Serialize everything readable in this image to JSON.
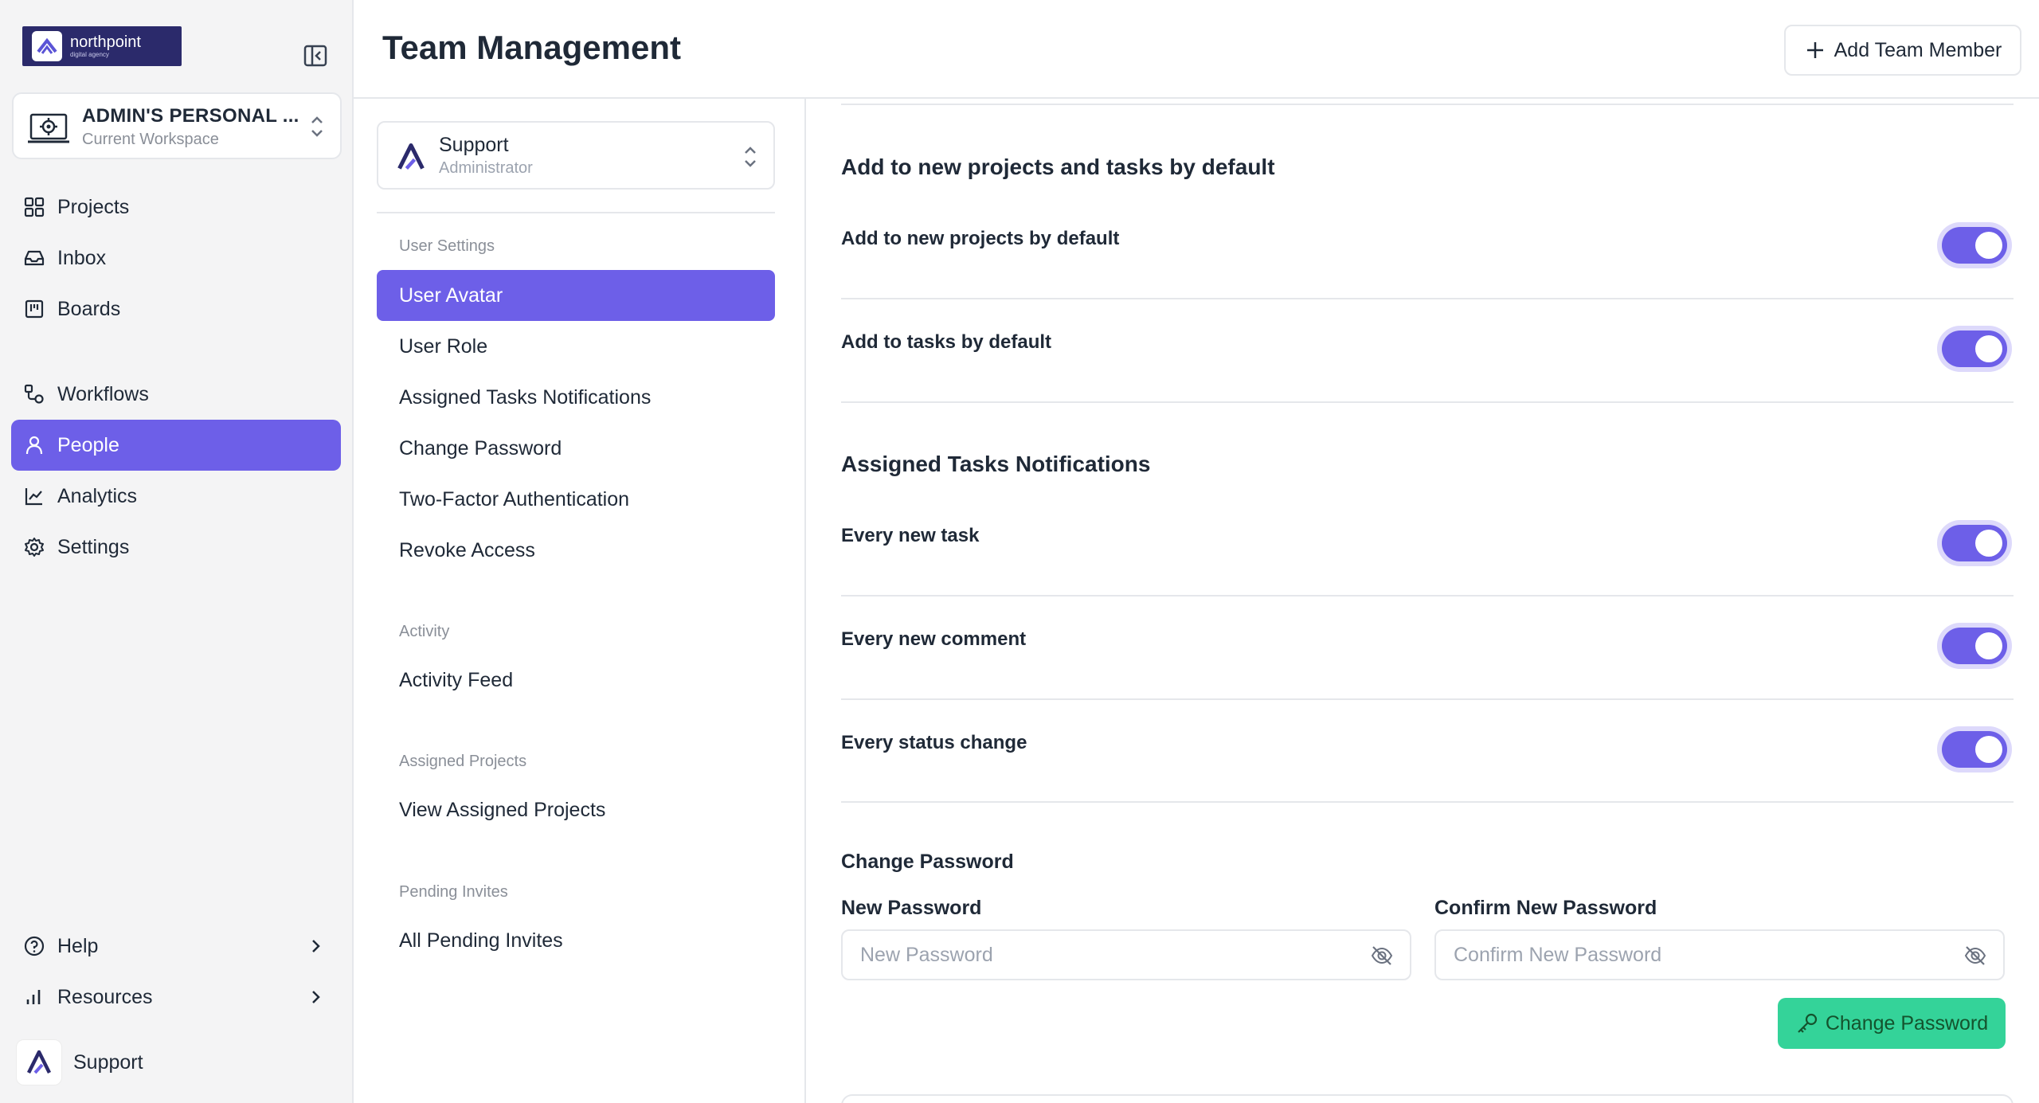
{
  "brand": {
    "name": "northpoint",
    "tagline": "digital agency"
  },
  "workspace": {
    "name": "ADMIN'S PERSONAL ...",
    "subtitle": "Current Workspace"
  },
  "nav": {
    "projects": "Projects",
    "inbox": "Inbox",
    "boards": "Boards",
    "workflows": "Workflows",
    "people": "People",
    "analytics": "Analytics",
    "settings": "Settings",
    "help": "Help",
    "resources": "Resources"
  },
  "current_user": {
    "name": "Support"
  },
  "header": {
    "title": "Team Management",
    "add_member_label": "Add Team Member"
  },
  "member_select": {
    "name": "Support",
    "role": "Administrator"
  },
  "settings_menu": {
    "user_settings": {
      "heading": "User Settings",
      "items": [
        "User Avatar",
        "User Role",
        "Assigned Tasks Notifications",
        "Change Password",
        "Two-Factor Authentication",
        "Revoke Access"
      ]
    },
    "activity": {
      "heading": "Activity",
      "items": [
        "Activity Feed"
      ]
    },
    "assigned_projects": {
      "heading": "Assigned Projects",
      "items": [
        "View Assigned Projects"
      ]
    },
    "pending_invites": {
      "heading": "Pending Invites",
      "items": [
        "All Pending Invites"
      ]
    }
  },
  "defaults_section": {
    "title": "Add to new projects and tasks by default",
    "rows": [
      {
        "label": "Add to new projects by default",
        "enabled": true
      },
      {
        "label": "Add to tasks by default",
        "enabled": true
      }
    ]
  },
  "notifications_section": {
    "title": "Assigned Tasks Notifications",
    "rows": [
      {
        "label": "Every new task",
        "enabled": true
      },
      {
        "label": "Every new comment",
        "enabled": true
      },
      {
        "label": "Every status change",
        "enabled": true
      }
    ]
  },
  "password_section": {
    "title": "Change Password",
    "new_label": "New Password",
    "new_placeholder": "New Password",
    "confirm_label": "Confirm New Password",
    "confirm_placeholder": "Confirm New Password",
    "button_label": "Change Password"
  },
  "colors": {
    "accent": "#6d5fe8",
    "success": "#34d399",
    "sidebar_bg": "#f4f4f5"
  },
  "icons": {
    "nav": [
      "grid-icon",
      "inbox-icon",
      "board-icon",
      "workflow-icon",
      "user-icon",
      "chart-line-icon",
      "gear-icon",
      "help-circle-icon",
      "bar-chart-icon"
    ],
    "misc": [
      "sidebar-collapse-icon",
      "chevron-up-down-icon",
      "plus-icon",
      "eye-off-icon",
      "key-icon"
    ]
  }
}
